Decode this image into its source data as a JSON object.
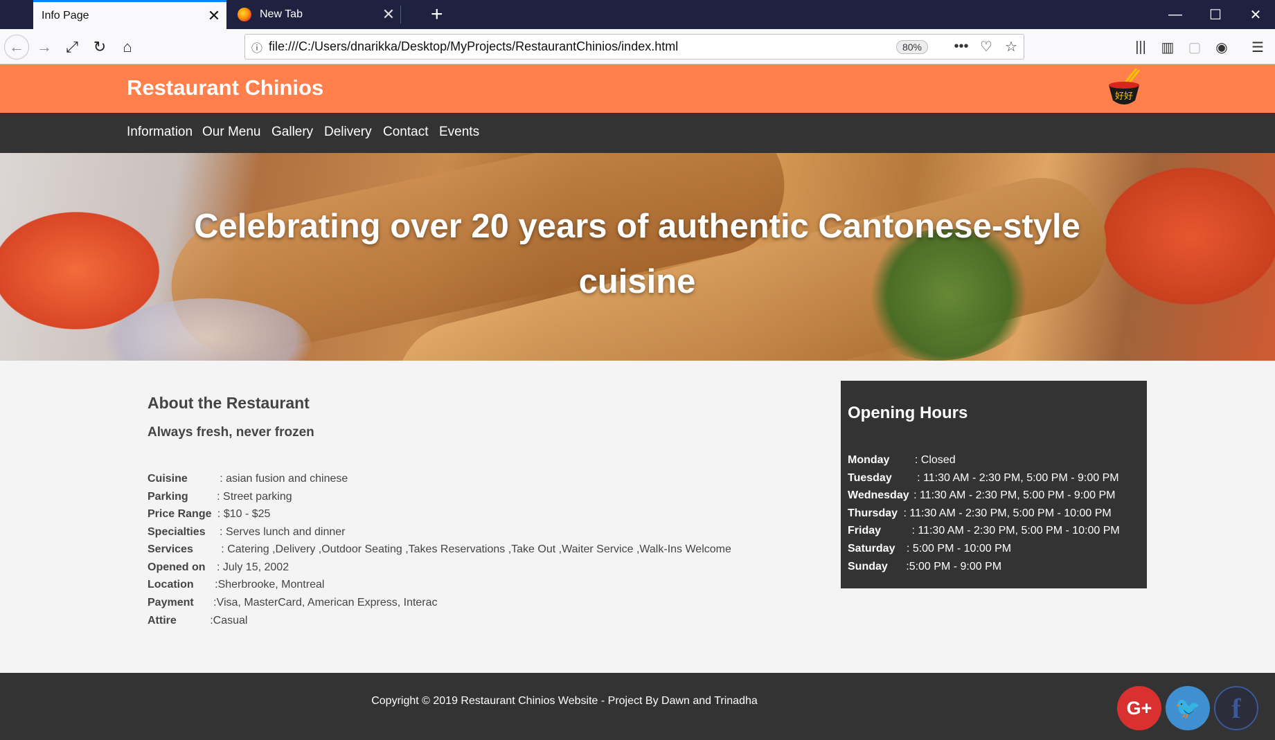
{
  "browser": {
    "tabs": [
      {
        "label": "Info Page",
        "active": true
      },
      {
        "label": "New Tab",
        "active": false
      }
    ],
    "new_tab": "+",
    "url": "file:///C:/Users/dnarikka/Desktop/MyProjects/RestaurantChinios/index.html",
    "zoom": "80%",
    "page_actions": "•••",
    "window_controls": {
      "minimize": "—",
      "maximize": "☐",
      "close": "✕"
    }
  },
  "site": {
    "title": "Restaurant Chinios",
    "logo_text": "好好",
    "nav": [
      "Information",
      "Our Menu",
      "Gallery",
      "Delivery",
      "Contact",
      "Events"
    ],
    "hero_text": "Celebrating over 20 years of authentic Cantonese-style cuisine"
  },
  "about": {
    "heading": "About the Restaurant",
    "tagline": "Always fresh, never frozen",
    "details": [
      {
        "label": "Cuisine",
        "sep": " : ",
        "value": "asian fusion and chinese"
      },
      {
        "label": "Parking",
        "sep": " : ",
        "value": "Street parking"
      },
      {
        "label": "Price Range",
        "sep": " : ",
        "value": "$10 - $25"
      },
      {
        "label": "Specialties",
        "sep": " : ",
        "value": "Serves lunch and dinner"
      },
      {
        "label": "Services",
        "sep": " : ",
        "value": "Catering ,Delivery ,Outdoor Seating ,Takes Reservations ,Take Out ,Waiter Service ,Walk-Ins Welcome"
      },
      {
        "label": "Opened on",
        "sep": " : ",
        "value": "July 15, 2002"
      },
      {
        "label": "Location",
        "sep": " :",
        "value": "Sherbrooke, Montreal"
      },
      {
        "label": "Payment",
        "sep": " :",
        "value": "Visa, MasterCard, American Express, Interac"
      },
      {
        "label": "Attire",
        "sep": " :",
        "value": "Casual"
      }
    ]
  },
  "hours": {
    "heading": "Opening Hours",
    "rows": [
      {
        "day": "Monday",
        "sep": " : ",
        "time": "Closed"
      },
      {
        "day": "Tuesday",
        "sep": " : ",
        "time": "11:30 AM - 2:30 PM, 5:00 PM - 9:00 PM"
      },
      {
        "day": "Wednesday",
        "sep": " : ",
        "time": "11:30 AM - 2:30 PM, 5:00 PM - 9:00 PM"
      },
      {
        "day": "Thursday",
        "sep": " : ",
        "time": "11:30 AM - 2:30 PM, 5:00 PM - 10:00 PM"
      },
      {
        "day": "Friday",
        "sep": " : ",
        "time": "11:30 AM - 2:30 PM, 5:00 PM - 10:00 PM"
      },
      {
        "day": "Saturday",
        "sep": " : ",
        "time": "5:00 PM - 10:00 PM"
      },
      {
        "day": "Sunday",
        "sep": " :",
        "time": "5:00 PM - 9:00 PM"
      }
    ]
  },
  "footer": {
    "copyright": "Copyright © 2019 Restaurant Chinios Website - Project By Dawn and Trinadha",
    "social": {
      "google": "G+",
      "twitter": "🐦",
      "facebook": "f"
    }
  },
  "colors": {
    "header": "#ff7f4d",
    "dark": "#333333",
    "page_bg": "#f4f4f4"
  }
}
